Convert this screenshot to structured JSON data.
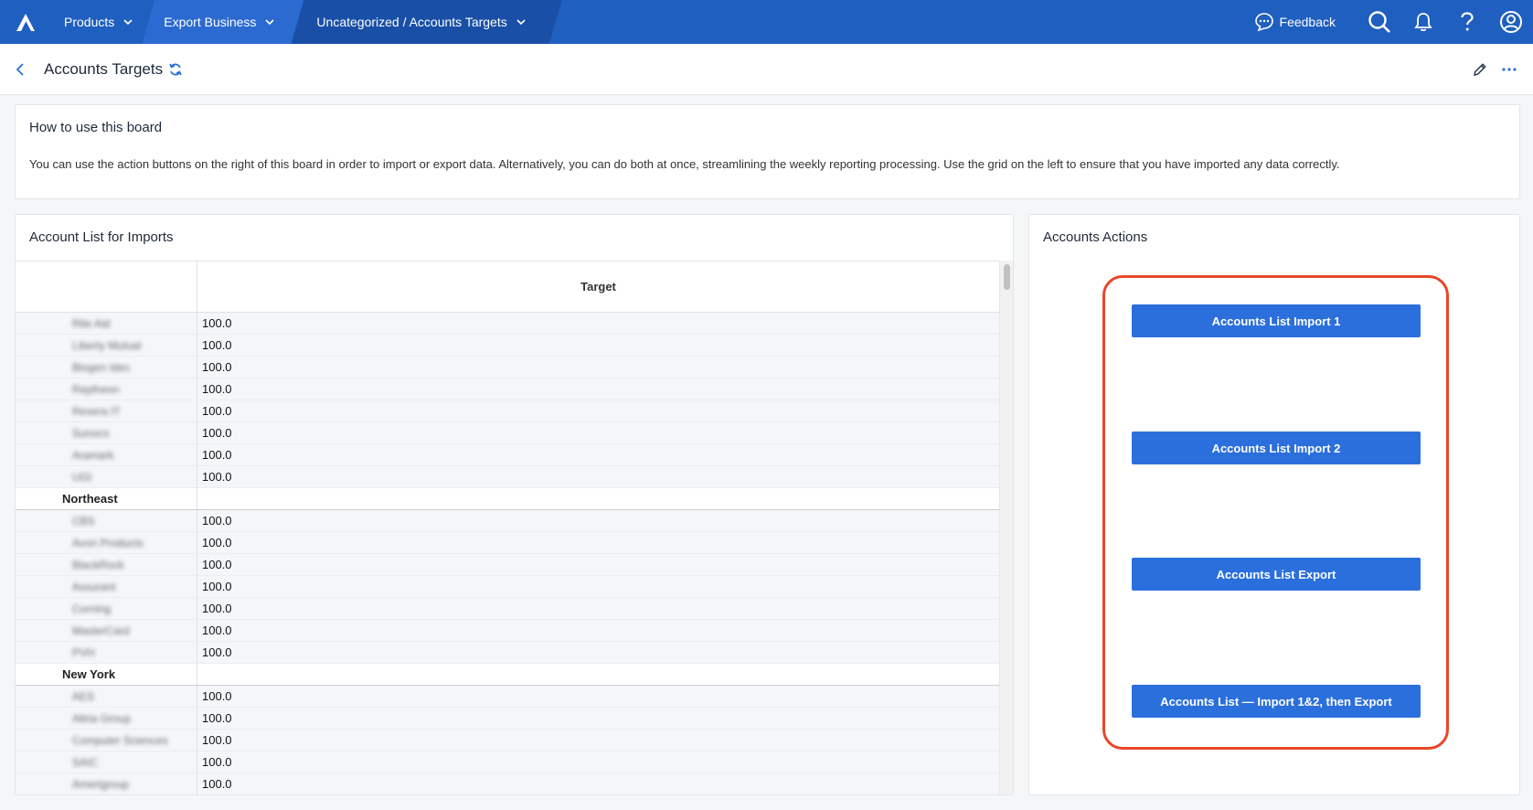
{
  "nav": {
    "products_label": "Products",
    "model_label": "Export Business",
    "board_path": "Uncategorized / Accounts Targets",
    "feedback_label": "Feedback",
    "brand_color": "#1f5fbf"
  },
  "title_bar": {
    "title": "Accounts Targets"
  },
  "info_card": {
    "title": "How to use this board",
    "body": "You can use the action buttons on the right of this board in order to import or export data. Alternatively, you can do both at once, streamlining the weekly reporting processing. Use the grid on the left to ensure that you have imported any data correctly."
  },
  "grid_card": {
    "title": "Account List for Imports",
    "column_header": "Target",
    "rows": [
      {
        "label": "Rite Aid",
        "value": "100.0",
        "group": false
      },
      {
        "label": "Liberty Mutual",
        "value": "100.0",
        "group": false
      },
      {
        "label": "Biogen Idec",
        "value": "100.0",
        "group": false
      },
      {
        "label": "Raytheon",
        "value": "100.0",
        "group": false
      },
      {
        "label": "Rexera IT",
        "value": "100.0",
        "group": false
      },
      {
        "label": "Sunoco",
        "value": "100.0",
        "group": false
      },
      {
        "label": "Aramark",
        "value": "100.0",
        "group": false
      },
      {
        "label": "UGI",
        "value": "100.0",
        "group": false
      },
      {
        "label": "Northeast",
        "value": "",
        "group": true
      },
      {
        "label": "CBS",
        "value": "100.0",
        "group": false
      },
      {
        "label": "Avon Products",
        "value": "100.0",
        "group": false
      },
      {
        "label": "BlackRock",
        "value": "100.0",
        "group": false
      },
      {
        "label": "Assurant",
        "value": "100.0",
        "group": false
      },
      {
        "label": "Corning",
        "value": "100.0",
        "group": false
      },
      {
        "label": "MasterCard",
        "value": "100.0",
        "group": false
      },
      {
        "label": "PVH",
        "value": "100.0",
        "group": false
      },
      {
        "label": "New York",
        "value": "",
        "group": true
      },
      {
        "label": "AES",
        "value": "100.0",
        "group": false
      },
      {
        "label": "Altria Group",
        "value": "100.0",
        "group": false
      },
      {
        "label": "Computer Sciences",
        "value": "100.0",
        "group": false
      },
      {
        "label": "SAIC",
        "value": "100.0",
        "group": false
      },
      {
        "label": "Amerigroup",
        "value": "100.0",
        "group": false
      }
    ]
  },
  "actions_card": {
    "title": "Accounts Actions",
    "buttons": [
      "Accounts List Import 1",
      "Accounts List Import 2",
      "Accounts List Export",
      "Accounts List — Import 1&2, then Export"
    ],
    "button_color": "#2a6fdc",
    "highlight_color": "#e8462a"
  }
}
